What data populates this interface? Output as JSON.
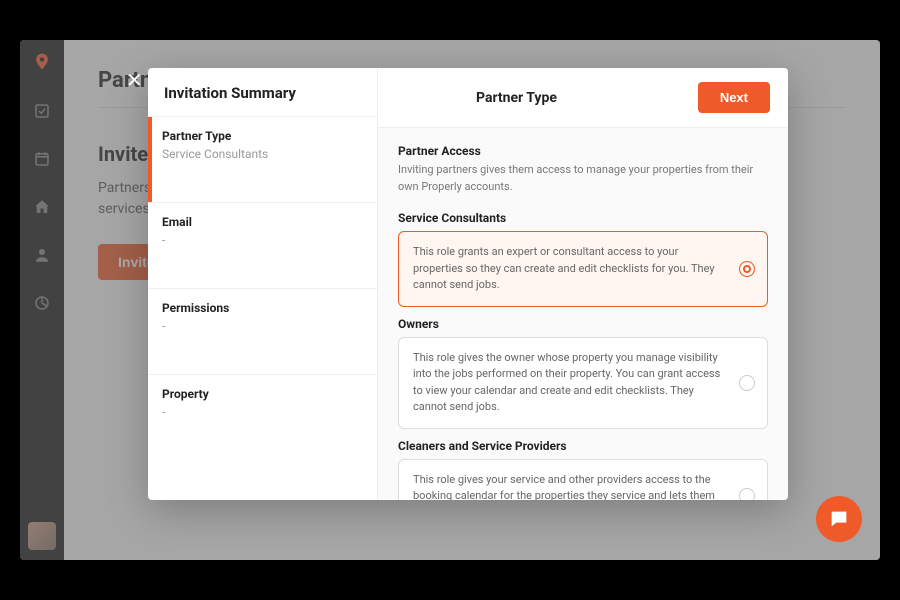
{
  "page": {
    "title": "Partners",
    "subhead": "Invite Yo",
    "body": "Partners can be cleaning companies to help you make and edit services. They can send jobs, not (You can tell them to have",
    "invite_button": "Invite Partner"
  },
  "modal": {
    "summary_title": "Invitation Summary",
    "header_title": "Partner Type",
    "next_button": "Next",
    "steps": [
      {
        "label": "Partner Type",
        "value": "Service Consultants"
      },
      {
        "label": "Email",
        "value": "-"
      },
      {
        "label": "Permissions",
        "value": "-"
      },
      {
        "label": "Property",
        "value": "-"
      }
    ],
    "access": {
      "title": "Partner Access",
      "desc": "Inviting partners gives them access to manage your properties from their own Properly accounts."
    },
    "roles": [
      {
        "title": "Service Consultants",
        "desc": "This role grants an expert or consultant access to your properties so they can create and edit checklists for you. They cannot send jobs.",
        "selected": true
      },
      {
        "title": "Owners",
        "desc": "This role gives the owner whose property you manage visibility into the jobs performed on their property. You can grant access to view your calendar and create and edit checklists. They cannot send jobs.",
        "selected": false
      },
      {
        "title": "Cleaners and Service Providers",
        "desc": "This role gives your service and other providers access to the booking calendar for the properties they service and lets them schedule their own jobs.",
        "selected": false
      }
    ]
  },
  "colors": {
    "accent": "#f05a28"
  }
}
